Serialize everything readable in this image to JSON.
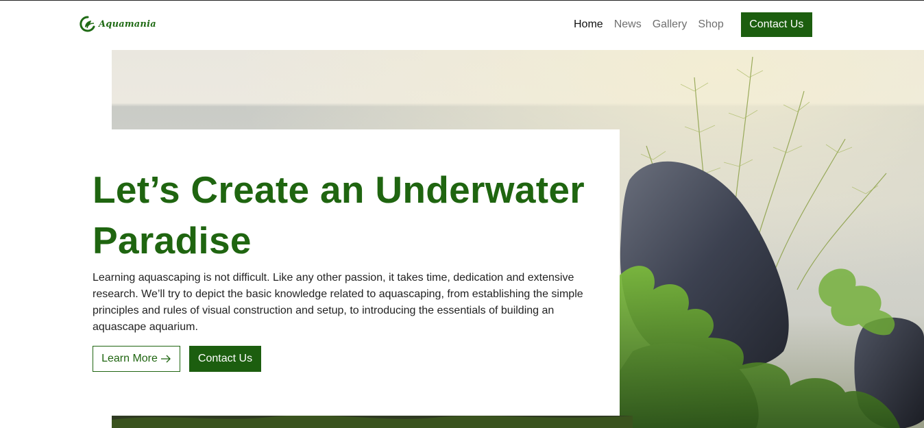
{
  "brand": {
    "name": "Aquamania",
    "logo_icon": "leaf-circle-icon",
    "color": "#1f6510"
  },
  "nav": {
    "items": [
      {
        "label": "Home",
        "active": true
      },
      {
        "label": "News",
        "active": false
      },
      {
        "label": "Gallery",
        "active": false
      },
      {
        "label": "Shop",
        "active": false
      }
    ],
    "cta_label": "Contact Us"
  },
  "hero": {
    "headline": "Let’s Create an Underwater Paradise",
    "body": "Learning aquascaping is not difficult. Like any other passion, it takes time, dedication and extensive research. We’ll try to depict the basic knowledge related to aquascaping, from establishing the simple principles and rules of visual construction and setup, to introducing the essentials of building an aquascape aquarium.",
    "learn_more_label": "Learn More",
    "learn_more_icon": "arrow-right-icon",
    "contact_label": "Contact Us"
  },
  "colors": {
    "accent": "#1c5e0f",
    "text": "#222222",
    "nav_muted": "#6f6f6f"
  }
}
